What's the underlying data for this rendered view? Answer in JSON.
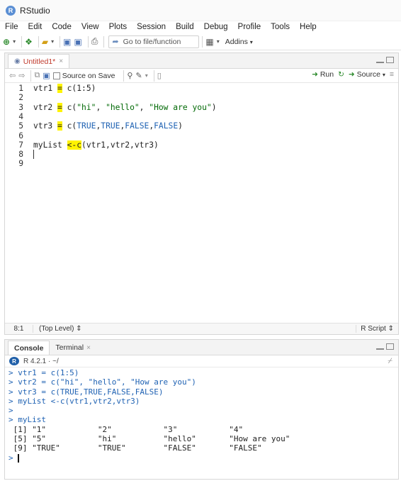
{
  "window": {
    "title": "RStudio"
  },
  "menu": [
    "File",
    "Edit",
    "Code",
    "View",
    "Plots",
    "Session",
    "Build",
    "Debug",
    "Profile",
    "Tools",
    "Help"
  ],
  "main_toolbar": {
    "goto_placeholder": "Go to file/function",
    "addins_label": "Addins"
  },
  "editor": {
    "tab_label": "Untitled1*",
    "source_on_save_label": "Source on Save",
    "run_label": "Run",
    "source_label": "Source",
    "lines": [
      {
        "num": "1",
        "pre": "vtr1 ",
        "op": "=",
        "post": " c(1:5)"
      },
      {
        "num": "2",
        "pre": "",
        "op": "",
        "post": ""
      },
      {
        "num": "3",
        "pre": "vtr2 ",
        "op": "=",
        "post": " c(\"hi\", \"hello\", \"How are you\")"
      },
      {
        "num": "4",
        "pre": "",
        "op": "",
        "post": ""
      },
      {
        "num": "5",
        "pre": "vtr3 ",
        "op": "=",
        "post": " c(TRUE,TRUE,FALSE,FALSE)"
      },
      {
        "num": "6",
        "pre": "",
        "op": "",
        "post": ""
      },
      {
        "num": "7",
        "pre": "myList ",
        "op": "<-c",
        "post": "(vtr1,vtr2,vtr3)"
      },
      {
        "num": "8",
        "pre": "",
        "op": "",
        "post": ""
      },
      {
        "num": "9",
        "pre": "",
        "op": "",
        "post": ""
      }
    ],
    "status": {
      "position": "8:1",
      "scope": "(Top Level)",
      "filetype": "R Script"
    }
  },
  "console": {
    "tab_console": "Console",
    "tab_terminal": "Terminal",
    "r_version": "R 4.2.1 · ~/",
    "lines": [
      {
        "type": "cmd",
        "text": "> vtr1 = c(1:5)"
      },
      {
        "type": "cmd",
        "text": "> vtr2 = c(\"hi\", \"hello\", \"How are you\")"
      },
      {
        "type": "cmd",
        "text": "> vtr3 = c(TRUE,TRUE,FALSE,FALSE)"
      },
      {
        "type": "cmd",
        "text": "> myList <-c(vtr1,vtr2,vtr3)"
      },
      {
        "type": "cmd",
        "text": ">"
      },
      {
        "type": "cmd",
        "text": "> myList"
      },
      {
        "type": "out",
        "text": " [1] \"1\"           \"2\"           \"3\"           \"4\""
      },
      {
        "type": "out",
        "text": " [5] \"5\"           \"hi\"          \"hello\"       \"How are you\""
      },
      {
        "type": "out",
        "text": " [9] \"TRUE\"        \"TRUE\"        \"FALSE\"       \"FALSE\""
      }
    ],
    "prompt": ">"
  },
  "colors": {
    "highlight": "#fff300",
    "keyword": "#1f62b3",
    "string": "#036a07",
    "tab_modified": "#c0392b"
  }
}
